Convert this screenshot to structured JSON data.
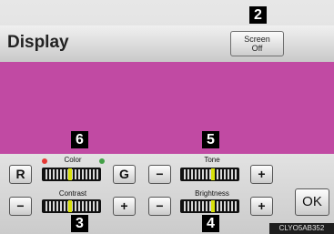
{
  "header": {
    "title": "Display",
    "screen_off_line1": "Screen",
    "screen_off_line2": "Off"
  },
  "callouts": {
    "color": "6",
    "tone": "5",
    "contrast": "3",
    "brightness": "4",
    "screen_off": "2"
  },
  "controls": {
    "color": {
      "label": "Color",
      "left_button": "R",
      "right_button": "G",
      "level": 0.5
    },
    "tone": {
      "label": "Tone",
      "left_button": "−",
      "right_button": "+",
      "level": 0.6
    },
    "contrast": {
      "label": "Contrast",
      "left_button": "−",
      "right_button": "+",
      "level": 0.5
    },
    "brightness": {
      "label": "Brightness",
      "left_button": "−",
      "right_button": "+",
      "level": 0.6
    }
  },
  "colors": {
    "dot_red": "#e53935",
    "dot_green": "#43a047",
    "preview": "#c14aa3",
    "indicator": "#d8e00b"
  },
  "ok_label": "OK",
  "image_id": "CLYO5AB352"
}
